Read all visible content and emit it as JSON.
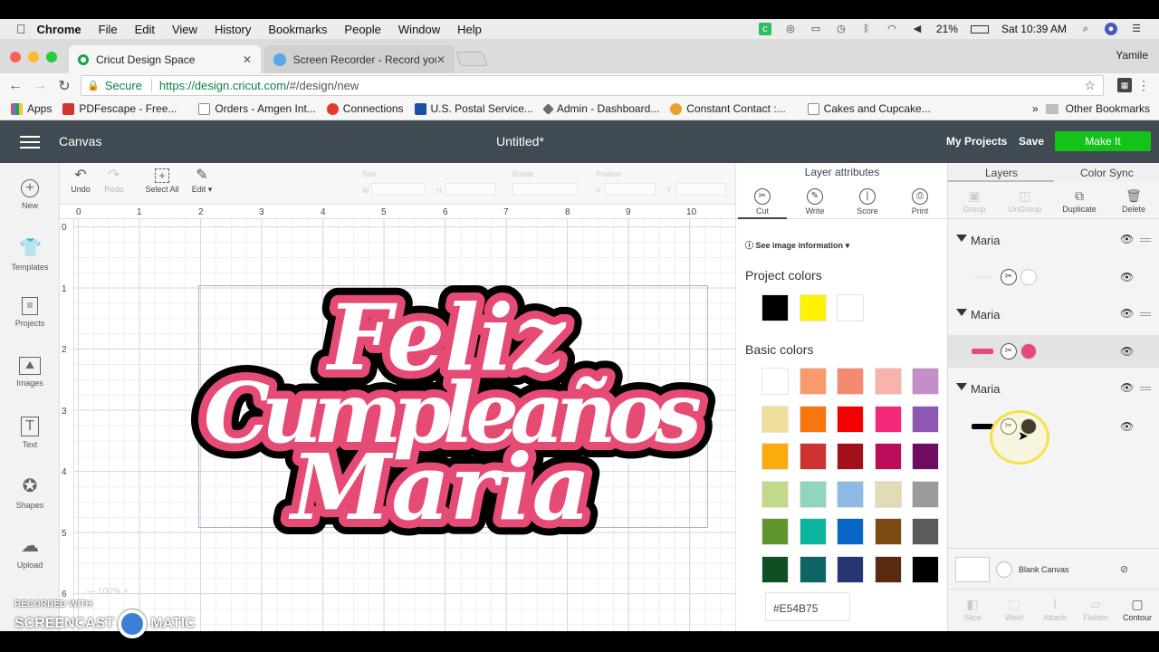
{
  "mac_menu": {
    "app": "Chrome",
    "items": [
      "File",
      "Edit",
      "View",
      "History",
      "Bookmarks",
      "People",
      "Window",
      "Help"
    ],
    "battery": "21%",
    "clock": "Sat 10:39 AM"
  },
  "browser": {
    "tabs": [
      {
        "label": "Cricut Design Space",
        "active": true
      },
      {
        "label": "Screen Recorder - Record you",
        "active": false
      }
    ],
    "user": "Yamile",
    "secure_label": "Secure",
    "url_main": "https://design.cricut.com",
    "url_rest": "/#/design/new",
    "bookmarks": [
      {
        "label": "Apps",
        "color": "#e0513f"
      },
      {
        "label": "PDFescape - Free...",
        "color": "#d0342c"
      },
      {
        "label": "Orders - Amgen Int...",
        "color": "#ffffff"
      },
      {
        "label": "Connections",
        "color": "#e33b2c"
      },
      {
        "label": "U.S. Postal Service...",
        "color": "#1b4fa0"
      },
      {
        "label": "Admin - Dashboard...",
        "color": "#6b6b6b"
      },
      {
        "label": "Constant Contact :...",
        "color": "#e7a12d"
      },
      {
        "label": "Cakes and Cupcake...",
        "color": "#ffffff"
      }
    ],
    "other_bookmarks": "Other Bookmarks"
  },
  "app": {
    "canvas_label": "Canvas",
    "title": "Untitled*",
    "my_projects": "My Projects",
    "save": "Save",
    "make_it": "Make It"
  },
  "sidebar": {
    "items": [
      {
        "label": "New",
        "icon": "plus-circle-icon"
      },
      {
        "label": "Templates",
        "icon": "shirt-icon"
      },
      {
        "label": "Projects",
        "icon": "projects-icon"
      },
      {
        "label": "Images",
        "icon": "image-icon"
      },
      {
        "label": "Text",
        "icon": "text-icon"
      },
      {
        "label": "Shapes",
        "icon": "shapes-icon"
      },
      {
        "label": "Upload",
        "icon": "upload-cloud-icon"
      }
    ]
  },
  "toolbar": {
    "undo": "Undo",
    "redo": "Redo",
    "select_all": "Select All",
    "edit": "Edit",
    "size_label": "Size",
    "w": "W",
    "h": "H",
    "rotate_label": "Rotate",
    "position_label": "Position",
    "x": "X",
    "y": "Y"
  },
  "ruler": {
    "top": [
      "0",
      "1",
      "2",
      "3",
      "4",
      "5",
      "6",
      "7",
      "8",
      "9",
      "10"
    ],
    "left": [
      "0",
      "1",
      "2",
      "3",
      "4",
      "5",
      "6"
    ]
  },
  "design": {
    "lines": [
      "Feliz",
      "Cumpleaños",
      "Maria"
    ],
    "fill": "#ffffff",
    "mid_layer": "#e54b75",
    "outer_layer": "#000000"
  },
  "zoom": "100%",
  "layer_attributes": {
    "title": "Layer attributes",
    "tabs": [
      {
        "label": "Cut",
        "glyph": "✂"
      },
      {
        "label": "Write",
        "glyph": "✎"
      },
      {
        "label": "Score",
        "glyph": "❘"
      },
      {
        "label": "Print",
        "glyph": "⎙"
      }
    ],
    "see_info": "See image information",
    "project_colors_label": "Project colors",
    "project_colors": [
      "#000000",
      "#fff200",
      "#ffffff"
    ],
    "basic_colors_label": "Basic colors",
    "basic_colors": [
      "#ffffff",
      "#f79a6c",
      "#f48a6f",
      "#f8b3ad",
      "#c48fc9",
      "#f0e09d",
      "#f7760d",
      "#f40000",
      "#f5287a",
      "#8e57b1",
      "#fcab0f",
      "#cf332f",
      "#a3101a",
      "#bb0d5c",
      "#6d0c60",
      "#c2d88b",
      "#8fd6bd",
      "#8ebae8",
      "#e2dbb8",
      "#9a9a9a",
      "#61962d",
      "#0bb59e",
      "#0866c6",
      "#7c4b15",
      "#5b5b5b",
      "#0e4f24",
      "#0e6565",
      "#283573",
      "#5a2a10",
      "#000000"
    ],
    "hex": "#E54B75"
  },
  "layers_panel": {
    "tab_layers": "Layers",
    "tab_color_sync": "Color Sync",
    "tools": [
      {
        "label": "Group",
        "enabled": false
      },
      {
        "label": "UnGroup",
        "enabled": false
      },
      {
        "label": "Duplicate",
        "enabled": true
      },
      {
        "label": "Delete",
        "enabled": true
      }
    ],
    "groups": [
      {
        "name": "Maria",
        "color": "#ffffff"
      },
      {
        "name": "Maria",
        "color": "#e54b75"
      },
      {
        "name": "Maria",
        "color": "#000000"
      }
    ],
    "blank_canvas": "Blank Canvas",
    "bottom_tools": [
      {
        "label": "Slice",
        "enabled": false
      },
      {
        "label": "Weld",
        "enabled": false
      },
      {
        "label": "Attach",
        "enabled": false
      },
      {
        "label": "Flatten",
        "enabled": false
      },
      {
        "label": "Contour",
        "enabled": true
      }
    ]
  },
  "watermark": {
    "line1": "RECORDED WITH",
    "line2a": "SCREENCAST",
    "line2b": "MATIC"
  }
}
